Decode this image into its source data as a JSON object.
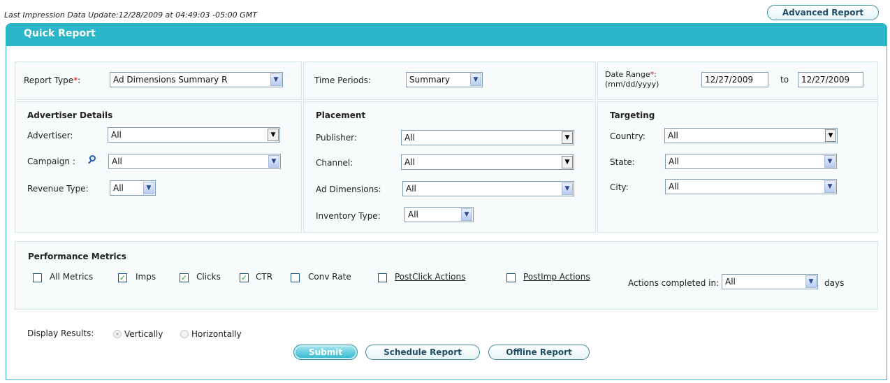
{
  "last_update": "Last Impression Data Update:12/28/2009 at 04:49:03 -05:00 GMT",
  "advanced_report_label": "Advanced Report",
  "panel_title": "Quick Report",
  "report_type": {
    "label": "Report Type",
    "required_mark": "*",
    "colon": ":",
    "value": "Ad Dimensions Summary R"
  },
  "time_periods": {
    "label": "Time Periods:",
    "value": "Summary"
  },
  "date_range": {
    "label": "Date Range",
    "required_mark": "*",
    "colon": ":",
    "format": "(mm/dd/yyyy)",
    "from": "12/27/2009",
    "to_label": "to",
    "to": "12/27/2009"
  },
  "advertiser": {
    "header": "Advertiser Details",
    "advertiser_label": "Advertiser:",
    "advertiser_value": "All",
    "campaign_label": "Campaign :",
    "campaign_value": "All",
    "revenue_label": "Revenue Type:",
    "revenue_value": "All"
  },
  "placement": {
    "header": "Placement",
    "publisher_label": "Publisher:",
    "publisher_value": "All",
    "channel_label": "Channel:",
    "channel_value": "All",
    "ad_dimensions_label": "Ad Dimensions:",
    "ad_dimensions_value": "All",
    "inventory_label": "Inventory Type:",
    "inventory_value": "All"
  },
  "targeting": {
    "header": "Targeting",
    "country_label": "Country:",
    "country_value": "All",
    "state_label": "State:",
    "state_value": "All",
    "city_label": "City:",
    "city_value": "All"
  },
  "metrics": {
    "header": "Performance Metrics",
    "all_metrics": "All Metrics",
    "imps": "Imps",
    "clicks": "Clicks",
    "ctr": "CTR",
    "conv_rate": "Conv Rate",
    "postclick": "PostClick Actions",
    "postimp": "PostImp Actions",
    "actions_label": "Actions completed in:",
    "actions_value": "All",
    "days": "days"
  },
  "display": {
    "label": "Display Results:",
    "vertically": "Vertically",
    "horizontally": "Horizontally"
  },
  "buttons": {
    "submit": "Submit",
    "schedule": "Schedule Report",
    "offline": "Offline Report"
  },
  "icons": {
    "dropdown": "chevron-down-icon",
    "search": "search-icon",
    "check": "check-icon"
  }
}
